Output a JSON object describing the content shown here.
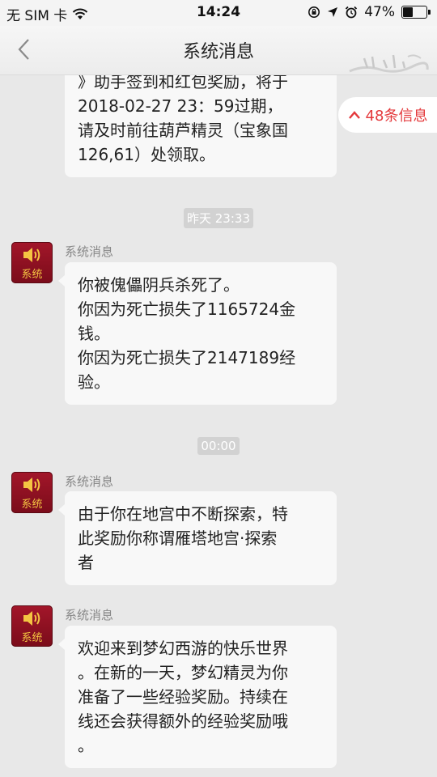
{
  "status_bar": {
    "carrier": "无 SIM 卡",
    "time": "14:24",
    "battery_percent": "47%",
    "battery_level": 0.47
  },
  "header": {
    "title": "系统消息"
  },
  "jump_button": {
    "label": "48条信息"
  },
  "colors": {
    "accent_red": "#e4393c",
    "avatar_red": "#a3162a",
    "avatar_gold": "#f4c542"
  },
  "messages": [
    {
      "sender": "",
      "lines": [
        "》助手签到和红包奖励，将于",
        "2018-02-27 23：59过期，",
        "请及时前往葫芦精灵（宝象国",
        "126,61）处领取。"
      ]
    },
    {
      "timestamp": "昨天 23:33"
    },
    {
      "sender": "系统消息",
      "avatar_label": "系统",
      "lines": [
        "你被傀儡阴兵杀死了。",
        "你因为死亡损失了1165724金",
        "钱。",
        "你因为死亡损失了2147189经",
        "验。"
      ]
    },
    {
      "timestamp": "00:00"
    },
    {
      "sender": "系统消息",
      "avatar_label": "系统",
      "lines": [
        "由于你在地宫中不断探索，特",
        "此奖励你称谓雁塔地宫·探索",
        "者"
      ]
    },
    {
      "sender": "系统消息",
      "avatar_label": "系统",
      "lines": [
        "欢迎来到梦幻西游的快乐世界",
        "。在新的一天，梦幻精灵为你",
        "准备了一些经验奖励。持续在",
        "线还会获得额外的经验奖励哦",
        "。"
      ]
    }
  ]
}
